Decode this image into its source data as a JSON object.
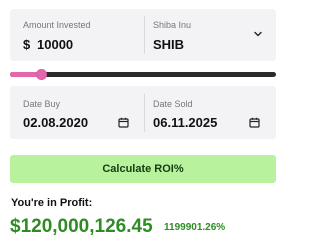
{
  "investment": {
    "amount_label": "Amount Invested",
    "currency_symbol": "$",
    "amount_value": "10000",
    "coin_label": "Shiba Inu",
    "coin_value": "SHIB",
    "dropdown_icon": "chevron-down-icon"
  },
  "slider": {
    "level": 0.12,
    "track_color": "#2b2b2b",
    "fill_color": "#e467ad"
  },
  "dates": {
    "buy_label": "Date Buy",
    "buy_value": "02.08.2020",
    "sold_label": "Date Sold",
    "sold_value": "06.11.2025",
    "calendar_icon": "calendar-icon"
  },
  "action": {
    "calculate_label": "Calculate ROI%",
    "button_color": "#b8f29d"
  },
  "result": {
    "status_text": "You're in Profit:",
    "profit_amount": "$120,000,126.45",
    "profit_percent": "1199901.26%",
    "profit_color": "#2f8b24"
  }
}
